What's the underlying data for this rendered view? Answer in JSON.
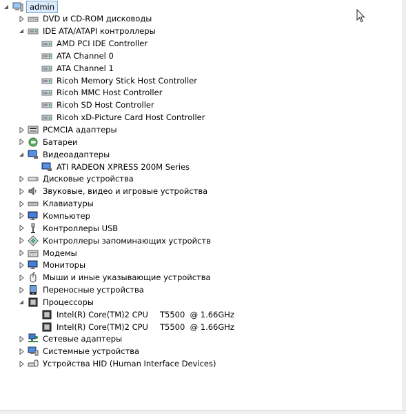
{
  "tree": {
    "items": [
      {
        "label": "admin",
        "level": 0,
        "expander": "expanded",
        "icon": "computer-icon",
        "selected": true
      },
      {
        "label": "DVD и CD-ROM дисководы",
        "level": 1,
        "expander": "collapsed",
        "icon": "dvd-drive-icon"
      },
      {
        "label": "IDE ATA/ATAPI контроллеры",
        "level": 1,
        "expander": "expanded",
        "icon": "ide-controller-icon"
      },
      {
        "label": "AMD PCI IDE Controller",
        "level": 2,
        "expander": "none",
        "icon": "ide-controller-icon"
      },
      {
        "label": "ATA Channel 0",
        "level": 2,
        "expander": "none",
        "icon": "ide-controller-icon"
      },
      {
        "label": "ATA Channel 1",
        "level": 2,
        "expander": "none",
        "icon": "ide-controller-icon"
      },
      {
        "label": "Ricoh Memory Stick Host Controller",
        "level": 2,
        "expander": "none",
        "icon": "ide-controller-icon"
      },
      {
        "label": "Ricoh MMC Host Controller",
        "level": 2,
        "expander": "none",
        "icon": "ide-controller-icon"
      },
      {
        "label": "Ricoh SD Host Controller",
        "level": 2,
        "expander": "none",
        "icon": "ide-controller-icon"
      },
      {
        "label": "Ricoh xD-Picture Card Host Controller",
        "level": 2,
        "expander": "none",
        "icon": "ide-controller-icon"
      },
      {
        "label": "PCMCIA адаптеры",
        "level": 1,
        "expander": "collapsed",
        "icon": "pcmcia-icon"
      },
      {
        "label": "Батареи",
        "level": 1,
        "expander": "collapsed",
        "icon": "battery-icon"
      },
      {
        "label": "Видеоадаптеры",
        "level": 1,
        "expander": "expanded",
        "icon": "display-adapter-icon"
      },
      {
        "label": "ATI RADEON XPRESS 200M Series",
        "level": 2,
        "expander": "none",
        "icon": "display-adapter-icon"
      },
      {
        "label": "Дисковые устройства",
        "level": 1,
        "expander": "collapsed",
        "icon": "disk-drive-icon"
      },
      {
        "label": "Звуковые, видео и игровые устройства",
        "level": 1,
        "expander": "collapsed",
        "icon": "speaker-icon"
      },
      {
        "label": "Клавиатуры",
        "level": 1,
        "expander": "collapsed",
        "icon": "keyboard-icon"
      },
      {
        "label": "Компьютер",
        "level": 1,
        "expander": "collapsed",
        "icon": "monitor-icon"
      },
      {
        "label": "Контроллеры USB",
        "level": 1,
        "expander": "collapsed",
        "icon": "usb-icon"
      },
      {
        "label": "Контроллеры запоминающих устройств",
        "level": 1,
        "expander": "collapsed",
        "icon": "storage-controller-icon"
      },
      {
        "label": "Модемы",
        "level": 1,
        "expander": "collapsed",
        "icon": "modem-icon"
      },
      {
        "label": "Мониторы",
        "level": 1,
        "expander": "collapsed",
        "icon": "monitor-icon"
      },
      {
        "label": "Мыши и иные указывающие устройства",
        "level": 1,
        "expander": "collapsed",
        "icon": "mouse-icon"
      },
      {
        "label": "Переносные устройства",
        "level": 1,
        "expander": "collapsed",
        "icon": "portable-device-icon"
      },
      {
        "label": "Процессоры",
        "level": 1,
        "expander": "expanded",
        "icon": "processor-icon"
      },
      {
        "label": "Intel(R) Core(TM)2 CPU",
        "label_spec": "T5500  @ 1.66GHz",
        "level": 2,
        "expander": "none",
        "icon": "processor-icon"
      },
      {
        "label": "Intel(R) Core(TM)2 CPU",
        "label_spec": "T5500  @ 1.66GHz",
        "level": 2,
        "expander": "none",
        "icon": "processor-icon"
      },
      {
        "label": "Сетевые адаптеры",
        "level": 1,
        "expander": "collapsed",
        "icon": "network-adapter-icon"
      },
      {
        "label": "Системные устройства",
        "level": 1,
        "expander": "collapsed",
        "icon": "system-device-icon"
      },
      {
        "label": "Устройства HID (Human Interface Devices)",
        "level": 1,
        "expander": "collapsed",
        "icon": "hid-icon"
      }
    ]
  },
  "colors": {
    "selection_bg": "#dcebfc",
    "selection_border": "#7da2ce",
    "expander": "#595959"
  }
}
